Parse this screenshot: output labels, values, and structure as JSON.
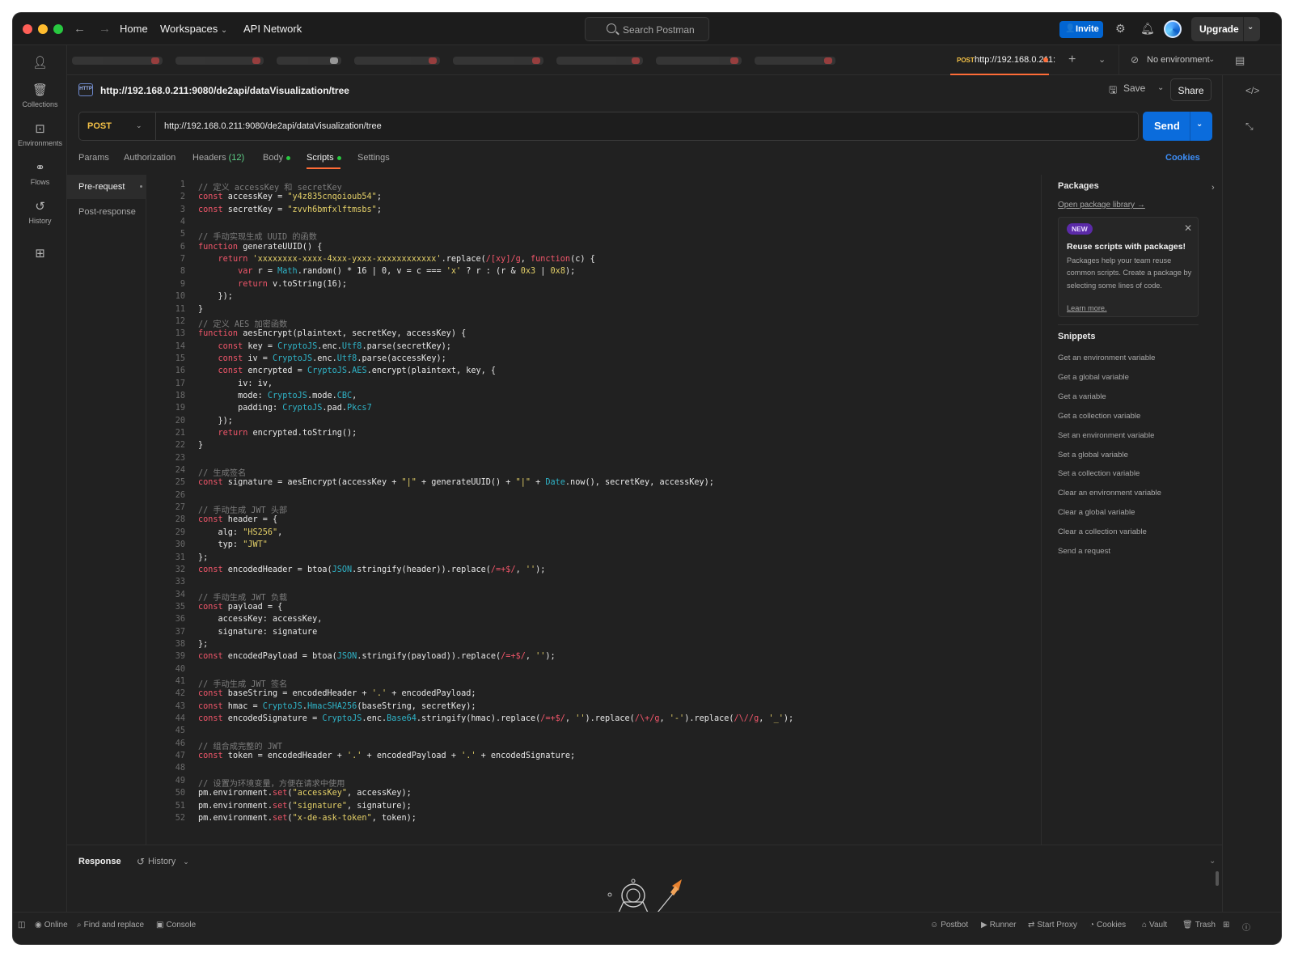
{
  "titlebar": {
    "nav_links": [
      "Home",
      "Workspaces",
      "API Network"
    ],
    "search_placeholder": "Search Postman",
    "invite_label": "Invite",
    "upgrade_label": "Upgrade"
  },
  "sidebar": {
    "items": [
      {
        "label": "",
        "icon": "user-icon"
      },
      {
        "label": "Collections",
        "icon": "collections-icon"
      },
      {
        "label": "Environments",
        "icon": "environments-icon"
      },
      {
        "label": "Flows",
        "icon": "flows-icon"
      },
      {
        "label": "History",
        "icon": "history-icon"
      },
      {
        "label": "",
        "icon": "add-workbench-icon"
      }
    ]
  },
  "tabs": {
    "active_method": "POST",
    "active_url": "http://192.168.0.211:",
    "environment": "No environment",
    "blurred_tab_colors": [
      "#ff4d4d",
      "#ff4d4d",
      "#ffffff",
      "#ff4d4d",
      "#ff4d4d",
      "#ff4d4d",
      "#ff4d4d",
      "#ff4d4d"
    ]
  },
  "request": {
    "title": "http://192.168.0.211:9080/de2api/dataVisualization/tree",
    "save_label": "Save",
    "share_label": "Share",
    "method": "POST",
    "url": "http://192.168.0.211:9080/de2api/dataVisualization/tree",
    "send_label": "Send",
    "tabs": {
      "params": "Params",
      "authorization": "Authorization",
      "headers": "Headers",
      "headers_count": "(12)",
      "body": "Body",
      "scripts": "Scripts",
      "settings": "Settings"
    },
    "cookies_label": "Cookies"
  },
  "scripts": {
    "pre_request": "Pre-request",
    "post_response": "Post-response",
    "lines": [
      [
        [
          "cm",
          "// 定义 accessKey 和 secretKey"
        ]
      ],
      [
        [
          "kw",
          "const"
        ],
        [
          "pl",
          " accessKey = "
        ],
        [
          "str",
          "\"y4z835cnqoioub54\""
        ],
        [
          "pl",
          ";"
        ]
      ],
      [
        [
          "kw",
          "const"
        ],
        [
          "pl",
          " secretKey = "
        ],
        [
          "str",
          "\"zvvh6bmfxlftmsbs\""
        ],
        [
          "pl",
          ";"
        ]
      ],
      [],
      [
        [
          "cm",
          "// 手动实现生成 UUID 的函数"
        ]
      ],
      [
        [
          "kw",
          "function"
        ],
        [
          "pl",
          " generateUUID() {"
        ]
      ],
      [
        [
          "pl",
          "    "
        ],
        [
          "kw",
          "return"
        ],
        [
          "pl",
          " "
        ],
        [
          "str",
          "'xxxxxxxx-xxxx-4xxx-yxxx-xxxxxxxxxxxx'"
        ],
        [
          "pl",
          ".replace("
        ],
        [
          "rx",
          "/[xy]/g"
        ],
        [
          "pl",
          ", "
        ],
        [
          "kw",
          "function"
        ],
        [
          "pl",
          "(c) {"
        ]
      ],
      [
        [
          "pl",
          "        "
        ],
        [
          "kw",
          "var"
        ],
        [
          "pl",
          " r = "
        ],
        [
          "obj",
          "Math"
        ],
        [
          "pl",
          ".random() * 16 | 0, v = c === "
        ],
        [
          "str",
          "'x'"
        ],
        [
          "pl",
          " ? r : (r & "
        ],
        [
          "num",
          "0x3"
        ],
        [
          "pl",
          " | "
        ],
        [
          "num",
          "0x8"
        ],
        [
          "pl",
          ");"
        ]
      ],
      [
        [
          "pl",
          "        "
        ],
        [
          "kw",
          "return"
        ],
        [
          "pl",
          " v.toString(16);"
        ]
      ],
      [
        [
          "pl",
          "    });"
        ]
      ],
      [
        [
          "pl",
          "}"
        ]
      ],
      [
        [
          "cm",
          "// 定义 AES 加密函数"
        ]
      ],
      [
        [
          "kw",
          "function"
        ],
        [
          "pl",
          " aesEncrypt(plaintext, secretKey, accessKey) {"
        ]
      ],
      [
        [
          "pl",
          "    "
        ],
        [
          "kw",
          "const"
        ],
        [
          "pl",
          " key = "
        ],
        [
          "obj",
          "CryptoJS"
        ],
        [
          "pl",
          ".enc."
        ],
        [
          "obj",
          "Utf8"
        ],
        [
          "pl",
          ".parse(secretKey);"
        ]
      ],
      [
        [
          "pl",
          "    "
        ],
        [
          "kw",
          "const"
        ],
        [
          "pl",
          " iv = "
        ],
        [
          "obj",
          "CryptoJS"
        ],
        [
          "pl",
          ".enc."
        ],
        [
          "obj",
          "Utf8"
        ],
        [
          "pl",
          ".parse(accessKey);"
        ]
      ],
      [
        [
          "pl",
          "    "
        ],
        [
          "kw",
          "const"
        ],
        [
          "pl",
          " encrypted = "
        ],
        [
          "obj",
          "CryptoJS"
        ],
        [
          "pl",
          "."
        ],
        [
          "obj",
          "AES"
        ],
        [
          "pl",
          ".encrypt(plaintext, key, {"
        ]
      ],
      [
        [
          "pl",
          "        iv: iv,"
        ]
      ],
      [
        [
          "pl",
          "        mode: "
        ],
        [
          "obj",
          "CryptoJS"
        ],
        [
          "pl",
          ".mode."
        ],
        [
          "obj",
          "CBC"
        ],
        [
          "pl",
          ","
        ]
      ],
      [
        [
          "pl",
          "        padding: "
        ],
        [
          "obj",
          "CryptoJS"
        ],
        [
          "pl",
          ".pad."
        ],
        [
          "obj",
          "Pkcs7"
        ]
      ],
      [
        [
          "pl",
          "    });"
        ]
      ],
      [
        [
          "pl",
          "    "
        ],
        [
          "kw",
          "return"
        ],
        [
          "pl",
          " encrypted.toString();"
        ]
      ],
      [
        [
          "pl",
          "}"
        ]
      ],
      [],
      [
        [
          "cm",
          "// 生成签名"
        ]
      ],
      [
        [
          "kw",
          "const"
        ],
        [
          "pl",
          " signature = aesEncrypt(accessKey + "
        ],
        [
          "str",
          "\"|\""
        ],
        [
          "pl",
          " + generateUUID() + "
        ],
        [
          "str",
          "\"|\""
        ],
        [
          "pl",
          " + "
        ],
        [
          "obj",
          "Date"
        ],
        [
          "pl",
          ".now(), secretKey, accessKey);"
        ]
      ],
      [],
      [
        [
          "cm",
          "// 手动生成 JWT 头部"
        ]
      ],
      [
        [
          "kw",
          "const"
        ],
        [
          "pl",
          " header = {"
        ]
      ],
      [
        [
          "pl",
          "    alg: "
        ],
        [
          "str",
          "\"HS256\""
        ],
        [
          "pl",
          ","
        ]
      ],
      [
        [
          "pl",
          "    typ: "
        ],
        [
          "str",
          "\"JWT\""
        ]
      ],
      [
        [
          "pl",
          "};"
        ]
      ],
      [
        [
          "kw",
          "const"
        ],
        [
          "pl",
          " encodedHeader = btoa("
        ],
        [
          "obj",
          "JSON"
        ],
        [
          "pl",
          ".stringify(header)).replace("
        ],
        [
          "rx",
          "/=+$/"
        ],
        [
          "pl",
          ", "
        ],
        [
          "str",
          "''"
        ],
        [
          "pl",
          ");"
        ]
      ],
      [],
      [
        [
          "cm",
          "// 手动生成 JWT 负载"
        ]
      ],
      [
        [
          "kw",
          "const"
        ],
        [
          "pl",
          " payload = {"
        ]
      ],
      [
        [
          "pl",
          "    accessKey: accessKey,"
        ]
      ],
      [
        [
          "pl",
          "    signature: signature"
        ]
      ],
      [
        [
          "pl",
          "};"
        ]
      ],
      [
        [
          "kw",
          "const"
        ],
        [
          "pl",
          " encodedPayload = btoa("
        ],
        [
          "obj",
          "JSON"
        ],
        [
          "pl",
          ".stringify(payload)).replace("
        ],
        [
          "rx",
          "/=+$/"
        ],
        [
          "pl",
          ", "
        ],
        [
          "str",
          "''"
        ],
        [
          "pl",
          ");"
        ]
      ],
      [],
      [
        [
          "cm",
          "// 手动生成 JWT 签名"
        ]
      ],
      [
        [
          "kw",
          "const"
        ],
        [
          "pl",
          " baseString = encodedHeader + "
        ],
        [
          "str",
          "'.'"
        ],
        [
          "pl",
          " + encodedPayload;"
        ]
      ],
      [
        [
          "kw",
          "const"
        ],
        [
          "pl",
          " hmac = "
        ],
        [
          "obj",
          "CryptoJS"
        ],
        [
          "pl",
          "."
        ],
        [
          "obj",
          "HmacSHA256"
        ],
        [
          "pl",
          "(baseString, secretKey);"
        ]
      ],
      [
        [
          "kw",
          "const"
        ],
        [
          "pl",
          " encodedSignature = "
        ],
        [
          "obj",
          "CryptoJS"
        ],
        [
          "pl",
          ".enc."
        ],
        [
          "obj",
          "Base64"
        ],
        [
          "pl",
          ".stringify(hmac).replace("
        ],
        [
          "rx",
          "/=+$/"
        ],
        [
          "pl",
          ", "
        ],
        [
          "str",
          "''"
        ],
        [
          "pl",
          ").replace("
        ],
        [
          "rx",
          "/\\+/g"
        ],
        [
          "pl",
          ", "
        ],
        [
          "str",
          "'-'"
        ],
        [
          "pl",
          ").replace("
        ],
        [
          "rx",
          "/\\//g"
        ],
        [
          "pl",
          ", "
        ],
        [
          "str",
          "'_'"
        ],
        [
          "pl",
          ");"
        ]
      ],
      [],
      [
        [
          "cm",
          "// 组合成完整的 JWT"
        ]
      ],
      [
        [
          "kw",
          "const"
        ],
        [
          "pl",
          " token = encodedHeader + "
        ],
        [
          "str",
          "'.'"
        ],
        [
          "pl",
          " + encodedPayload + "
        ],
        [
          "str",
          "'.'"
        ],
        [
          "pl",
          " + encodedSignature;"
        ]
      ],
      [],
      [
        [
          "cm",
          "// 设置为环境变量，方便在请求中使用"
        ]
      ],
      [
        [
          "pl",
          "pm.environment."
        ],
        [
          "kw",
          "set"
        ],
        [
          "pl",
          "("
        ],
        [
          "str",
          "\"accessKey\""
        ],
        [
          "pl",
          ", accessKey);"
        ]
      ],
      [
        [
          "pl",
          "pm.environment."
        ],
        [
          "kw",
          "set"
        ],
        [
          "pl",
          "("
        ],
        [
          "str",
          "\"signature\""
        ],
        [
          "pl",
          ", signature);"
        ]
      ],
      [
        [
          "pl",
          "pm.environment."
        ],
        [
          "kw",
          "set"
        ],
        [
          "pl",
          "("
        ],
        [
          "str",
          "\"x-de-ask-token\""
        ],
        [
          "pl",
          ", token);"
        ]
      ]
    ]
  },
  "packages": {
    "title": "Packages",
    "library_link": "Open package library →",
    "card": {
      "badge": "NEW",
      "title": "Reuse scripts with packages!",
      "body": "Packages help your team reuse common scripts. Create a package by selecting some lines of code.",
      "learn_more": "Learn more."
    },
    "snippets_title": "Snippets",
    "snippets": [
      "Get an environment variable",
      "Get a global variable",
      "Get a variable",
      "Get a collection variable",
      "Set an environment variable",
      "Set a global variable",
      "Set a collection variable",
      "Clear an environment variable",
      "Clear a global variable",
      "Clear a collection variable",
      "Send a request"
    ]
  },
  "response": {
    "title": "Response",
    "history_label": "History"
  },
  "statusbar": {
    "left": [
      "Online",
      "Find and replace",
      "Console"
    ],
    "right": [
      "Postbot",
      "Runner",
      "Start Proxy",
      "Cookies",
      "Vault",
      "Trash"
    ]
  },
  "colors": {
    "accent": "#ff6c37",
    "send": "#0b6cdc",
    "method_post": "#f3c046",
    "link": "#3d8ef7"
  }
}
